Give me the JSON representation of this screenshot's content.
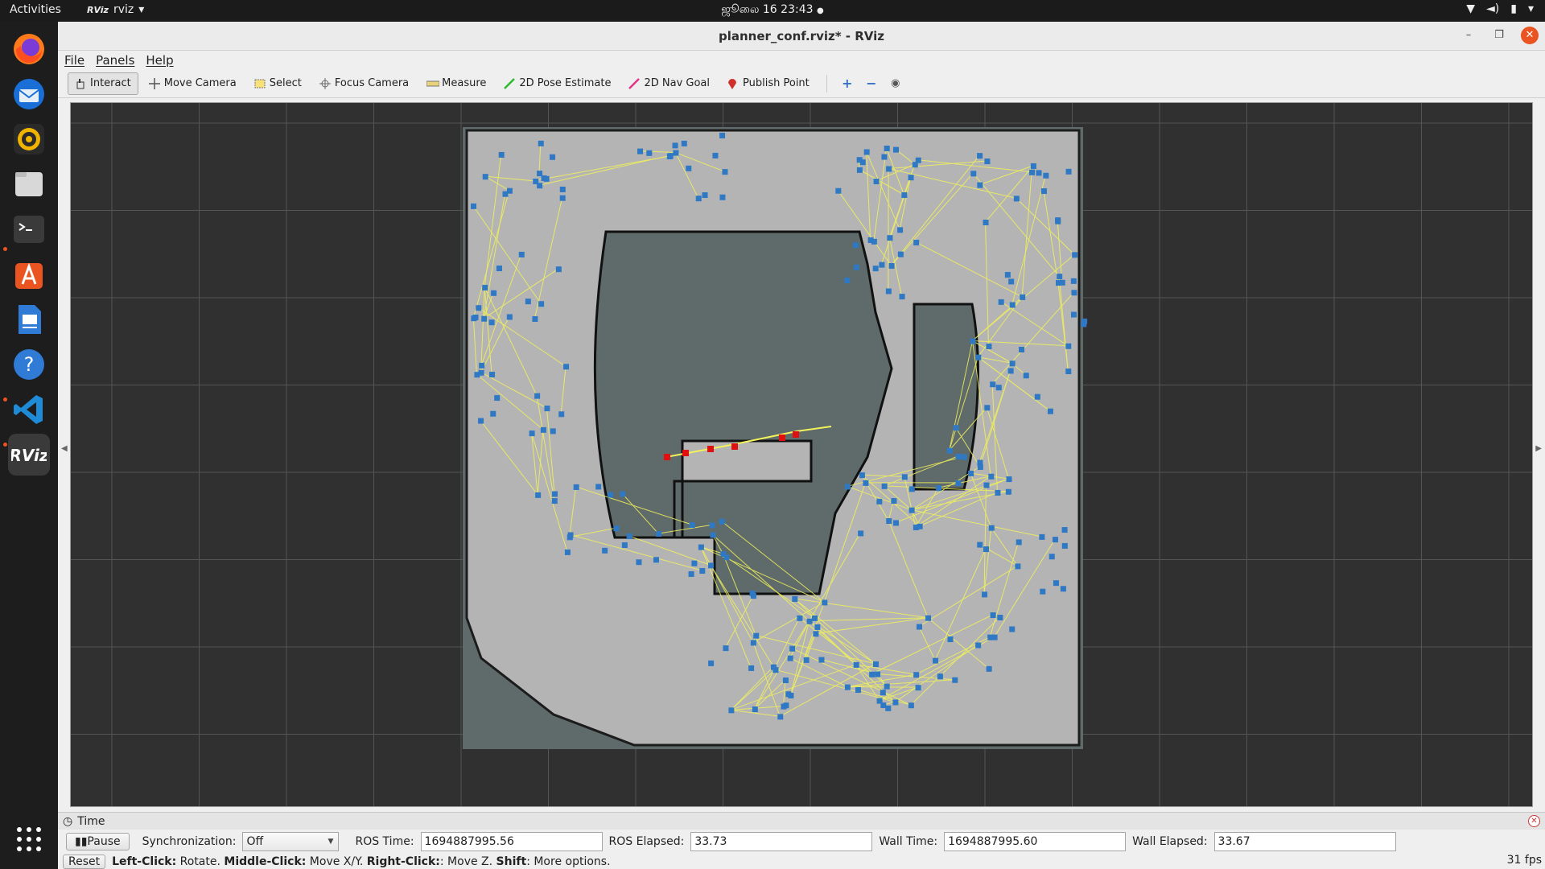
{
  "topbar": {
    "activities": "Activities",
    "app_name": "rviz",
    "app_badge": "RViz",
    "clock": "ஜூலை 16  23:43"
  },
  "window": {
    "title": "planner_conf.rviz* - RViz"
  },
  "menu": {
    "file": "File",
    "panels": "Panels",
    "help": "Help"
  },
  "toolbar": {
    "interact": "Interact",
    "move_camera": "Move Camera",
    "select": "Select",
    "focus_camera": "Focus Camera",
    "measure": "Measure",
    "pose_estimate": "2D Pose Estimate",
    "nav_goal": "2D Nav Goal",
    "publish_point": "Publish Point"
  },
  "time_panel": {
    "title": "Time",
    "pause": "Pause",
    "sync_label": "Synchronization:",
    "sync_value": "Off",
    "ros_time_label": "ROS Time:",
    "ros_time": "1694887995.56",
    "ros_elapsed_label": "ROS Elapsed:",
    "ros_elapsed": "33.73",
    "wall_time_label": "Wall Time:",
    "wall_time": "1694887995.60",
    "wall_elapsed_label": "Wall Elapsed:",
    "wall_elapsed": "33.67"
  },
  "status": {
    "reset": "Reset",
    "lc": "Left-Click:",
    "lc_text": " Rotate. ",
    "mc": "Middle-Click:",
    "mc_text": " Move X/Y. ",
    "rc": "Right-Click:",
    "rc_text": ": Move Z. ",
    "shift": "Shift",
    "shift_text": ": More options.",
    "fps": "31 fps"
  },
  "colors": {
    "accent": "#e95420",
    "grid_bg": "#303030",
    "map_unknown": "#5f6b6b",
    "map_free": "#b3b3b3",
    "roadmap_edges": "#f2f25a",
    "roadmap_nodes": "#2f78c4",
    "path": "#e01010"
  }
}
